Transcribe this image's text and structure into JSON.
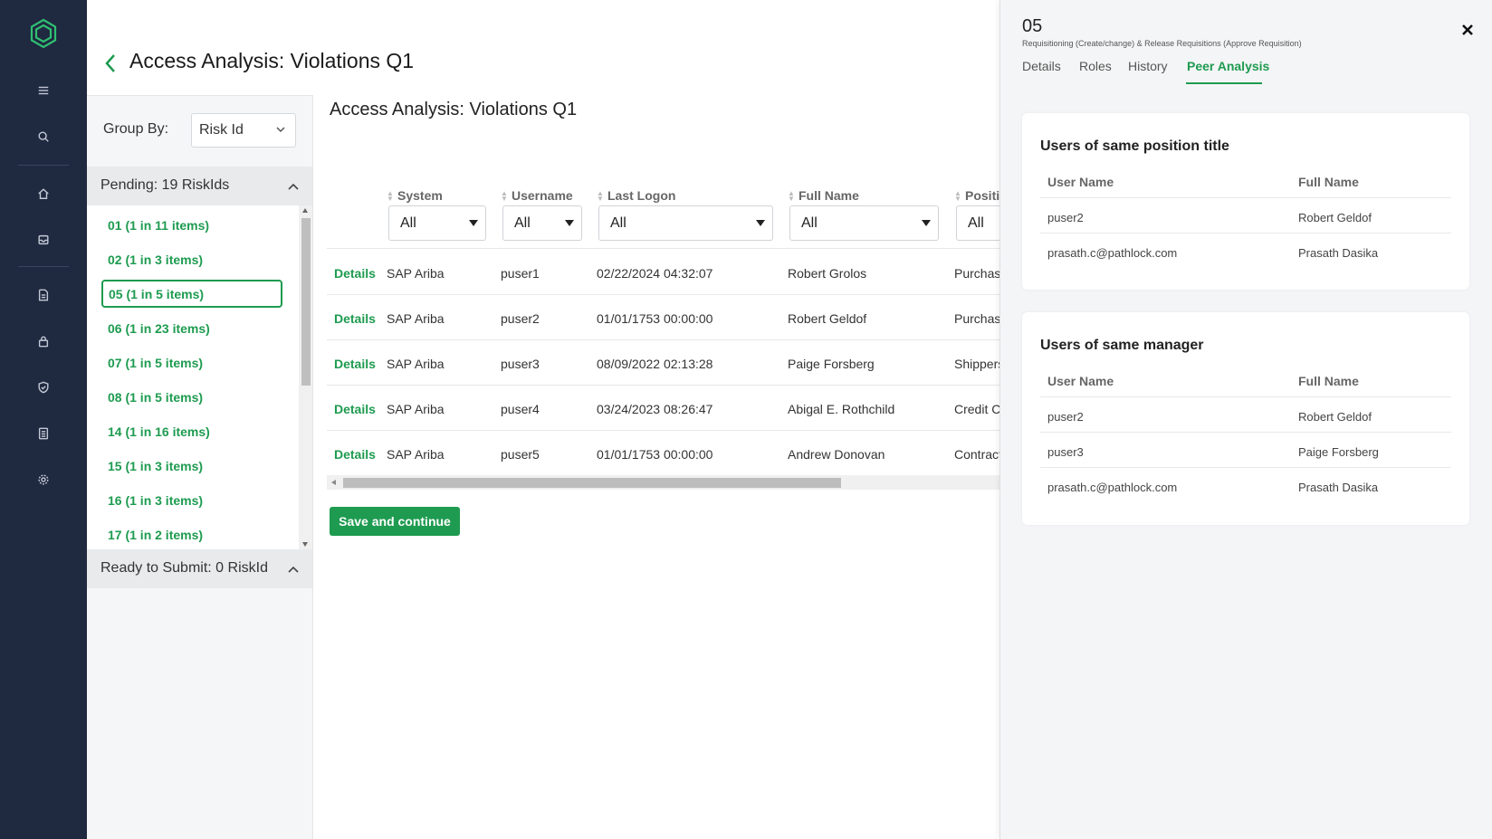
{
  "nav": {
    "icons": [
      "logo-icon",
      "menu-icon",
      "search-icon",
      "home-icon",
      "inbox-icon",
      "document-icon",
      "lock-icon",
      "shield-icon",
      "report-icon",
      "settings-icon"
    ]
  },
  "header": {
    "title": "Access Analysis: Violations Q1"
  },
  "group_panel": {
    "group_by_label": "Group By:",
    "group_by_value": "Risk Id",
    "pending_label": "Pending: 19 RiskIds",
    "ready_label": "Ready to Submit: 0 RiskId",
    "items": [
      "01 (1 in 11 items)",
      "02 (1 in 3 items)",
      "05 (1 in 5 items)",
      "06 (1 in 23 items)",
      "07 (1 in 5 items)",
      "08 (1 in 5 items)",
      "14 (1 in 16 items)",
      "15 (1 in 3 items)",
      "16 (1 in 3 items)",
      "17 (1 in 2 items)"
    ],
    "selected_item": "05 (1 in 5 items)"
  },
  "main": {
    "title": "Access Analysis: Violations Q1",
    "columns": [
      "System",
      "Username",
      "Last Logon",
      "Full Name",
      "Positi"
    ],
    "filter_value": "All",
    "details_label": "Details",
    "rows": [
      {
        "system": "SAP Ariba",
        "username": "puser1",
        "last_logon": "02/22/2024 04:32:07",
        "full_name": "Robert Grolos",
        "position": "Purchasi"
      },
      {
        "system": "SAP Ariba",
        "username": "puser2",
        "last_logon": "01/01/1753 00:00:00",
        "full_name": "Robert Geldof",
        "position": "Purchasi"
      },
      {
        "system": "SAP Ariba",
        "username": "puser3",
        "last_logon": "08/09/2022 02:13:28",
        "full_name": "Paige Forsberg",
        "position": "Shippers"
      },
      {
        "system": "SAP Ariba",
        "username": "puser4",
        "last_logon": "03/24/2023 08:26:47",
        "full_name": "Abigal E. Rothchild",
        "position": "Credit C"
      },
      {
        "system": "SAP Ariba",
        "username": "puser5",
        "last_logon": "01/01/1753 00:00:00",
        "full_name": "Andrew Donovan",
        "position": "Contract"
      }
    ],
    "save_label": "Save and continue"
  },
  "drawer": {
    "id": "05",
    "subtitle": "Requisitioning (Create/change) & Release Requisitions (Approve Requisition)",
    "tabs": [
      "Details",
      "Roles",
      "History",
      "Peer Analysis"
    ],
    "active_tab": "Peer Analysis",
    "same_position": {
      "title": "Users of same position title",
      "headers": [
        "User Name",
        "Full Name"
      ],
      "rows": [
        [
          "puser2",
          "Robert Geldof"
        ],
        [
          "prasath.c@pathlock.com",
          "Prasath Dasika"
        ]
      ]
    },
    "same_manager": {
      "title": "Users of same manager",
      "headers": [
        "User Name",
        "Full Name"
      ],
      "rows": [
        [
          "puser2",
          "Robert Geldof"
        ],
        [
          "puser3",
          "Paige Forsberg"
        ],
        [
          "prasath.c@pathlock.com",
          "Prasath Dasika"
        ]
      ]
    }
  },
  "colors": {
    "accent": "#1e9b50",
    "rail": "#1f2940"
  }
}
